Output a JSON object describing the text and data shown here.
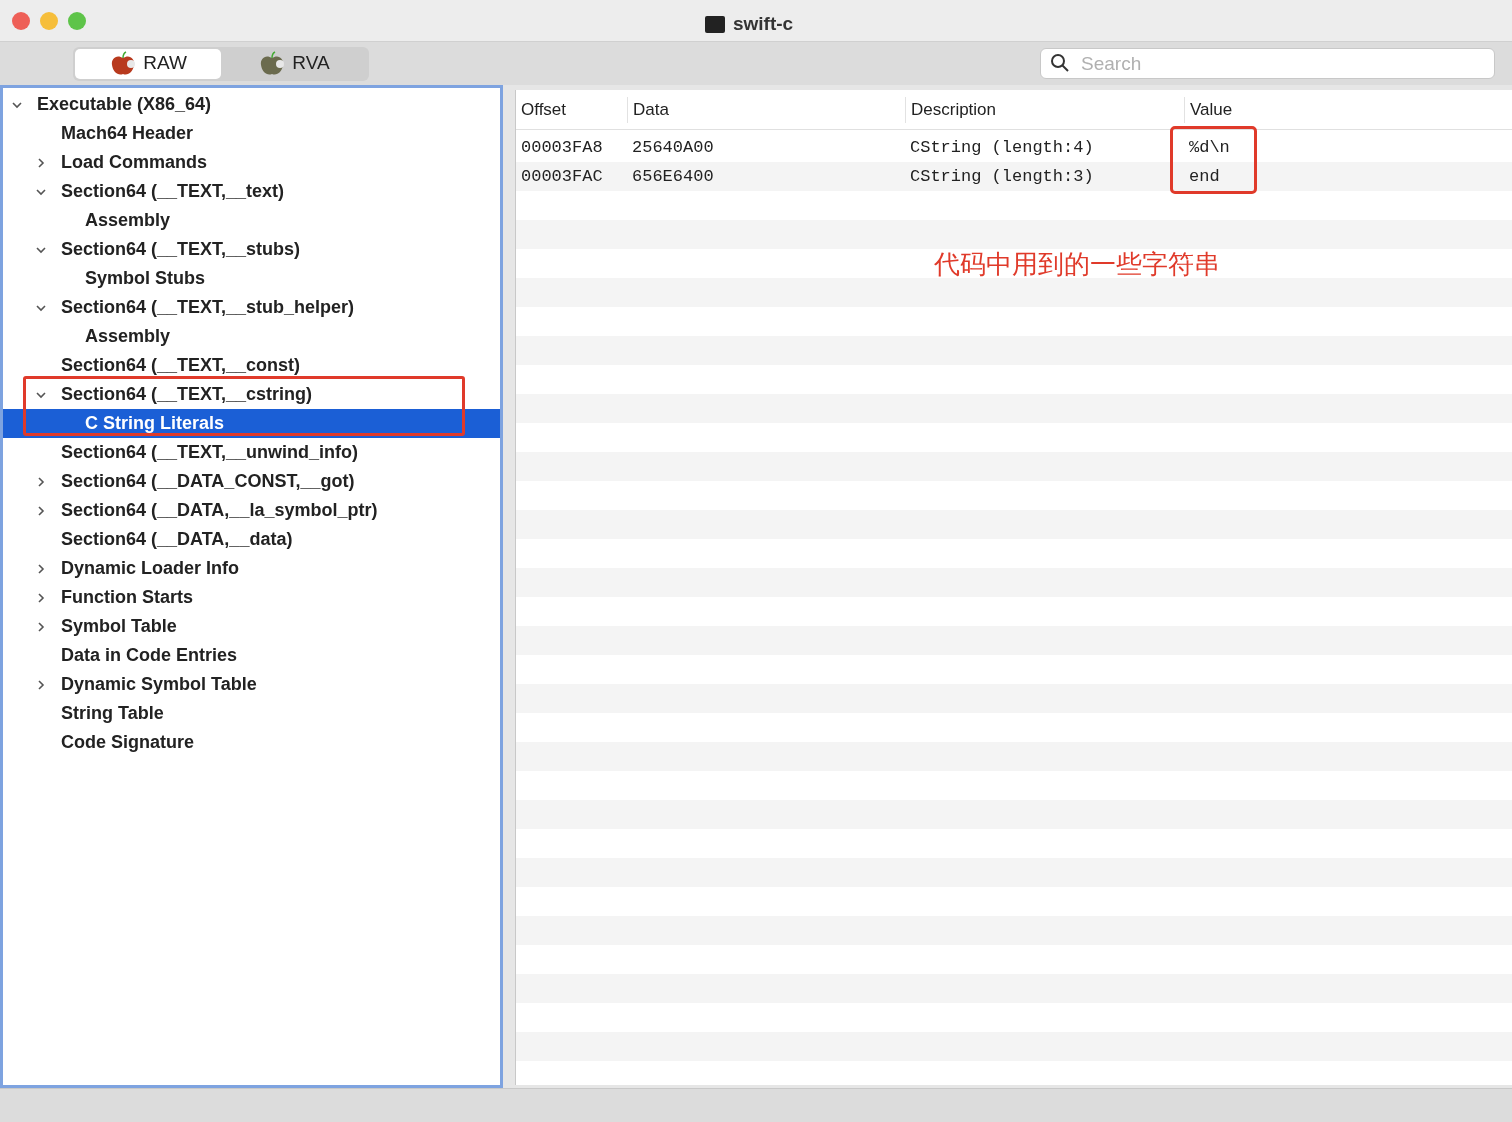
{
  "window": {
    "title": "swift-c"
  },
  "modes": [
    {
      "label": "RAW",
      "selected": true
    },
    {
      "label": "RVA",
      "selected": false
    }
  ],
  "search": {
    "placeholder": "Search"
  },
  "tree": [
    {
      "label": "Executable  (X86_64)",
      "expanded": true,
      "selected": false,
      "children": [
        {
          "label": "Mach64 Header",
          "selected": false
        },
        {
          "label": "Load Commands",
          "expanded": false,
          "selected": false
        },
        {
          "label": "Section64 (__TEXT,__text)",
          "expanded": true,
          "selected": false,
          "children": [
            {
              "label": "Assembly",
              "selected": false
            }
          ]
        },
        {
          "label": "Section64 (__TEXT,__stubs)",
          "expanded": true,
          "selected": false,
          "children": [
            {
              "label": "Symbol Stubs",
              "selected": false
            }
          ]
        },
        {
          "label": "Section64 (__TEXT,__stub_helper)",
          "expanded": true,
          "selected": false,
          "children": [
            {
              "label": "Assembly",
              "selected": false
            }
          ]
        },
        {
          "label": "Section64 (__TEXT,__const)",
          "selected": false
        },
        {
          "label": "Section64 (__TEXT,__cstring)",
          "expanded": true,
          "selected": false,
          "callout": true,
          "children": [
            {
              "label": "C String Literals",
              "selected": true
            }
          ]
        },
        {
          "label": "Section64 (__TEXT,__unwind_info)",
          "selected": false
        },
        {
          "label": "Section64 (__DATA_CONST,__got)",
          "expanded": false,
          "selected": false
        },
        {
          "label": "Section64 (__DATA,__la_symbol_ptr)",
          "expanded": false,
          "selected": false
        },
        {
          "label": "Section64 (__DATA,__data)",
          "selected": false
        },
        {
          "label": "Dynamic Loader Info",
          "expanded": false,
          "selected": false
        },
        {
          "label": "Function Starts",
          "expanded": false,
          "selected": false
        },
        {
          "label": "Symbol Table",
          "expanded": false,
          "selected": false
        },
        {
          "label": "Data in Code Entries",
          "selected": false
        },
        {
          "label": "Dynamic Symbol Table",
          "expanded": false,
          "selected": false
        },
        {
          "label": "String Table",
          "selected": false
        },
        {
          "label": "Code Signature",
          "selected": false
        }
      ]
    }
  ],
  "table": {
    "columns": [
      "Offset",
      "Data",
      "Description",
      "Value"
    ],
    "rows": [
      [
        "00003FA8",
        "25640A00",
        "CString (length:4)",
        "%d\\n"
      ],
      [
        "00003FAC",
        "656E6400",
        "CString (length:3)",
        "end"
      ]
    ],
    "value_callout": true,
    "annotation": "代码中用到的一些字符串"
  }
}
